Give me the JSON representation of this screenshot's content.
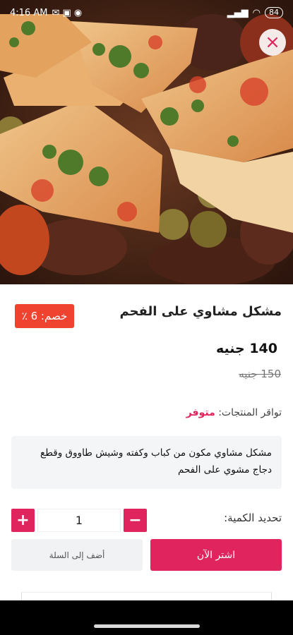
{
  "status_bar": {
    "time": "4:16 AM",
    "battery": "84"
  },
  "hero": {
    "image": "mixed-grill-photo"
  },
  "close_icon": "×",
  "product": {
    "title": "مشكل مشاوي على الفحم",
    "discount_label": "خصم: 6 ٪",
    "price": "140 جنيه",
    "old_price": "150 جنيه",
    "availability_label": "تواقر المنتجات:",
    "availability_value": "متوفر",
    "description": "مشكل مشاوي مكون من كباب وكفته وشيش طاووق وقطع دجاج مشوي على الفحم"
  },
  "quantity": {
    "label": "تحديد الكمية:",
    "value": "1",
    "minus": "−",
    "plus": "+"
  },
  "actions": {
    "buy_now": "اشتر الآن",
    "add_to_cart": "أضف إلى السلة"
  },
  "colors": {
    "accent": "#e0245e",
    "discount_bg": "#f0432f"
  }
}
